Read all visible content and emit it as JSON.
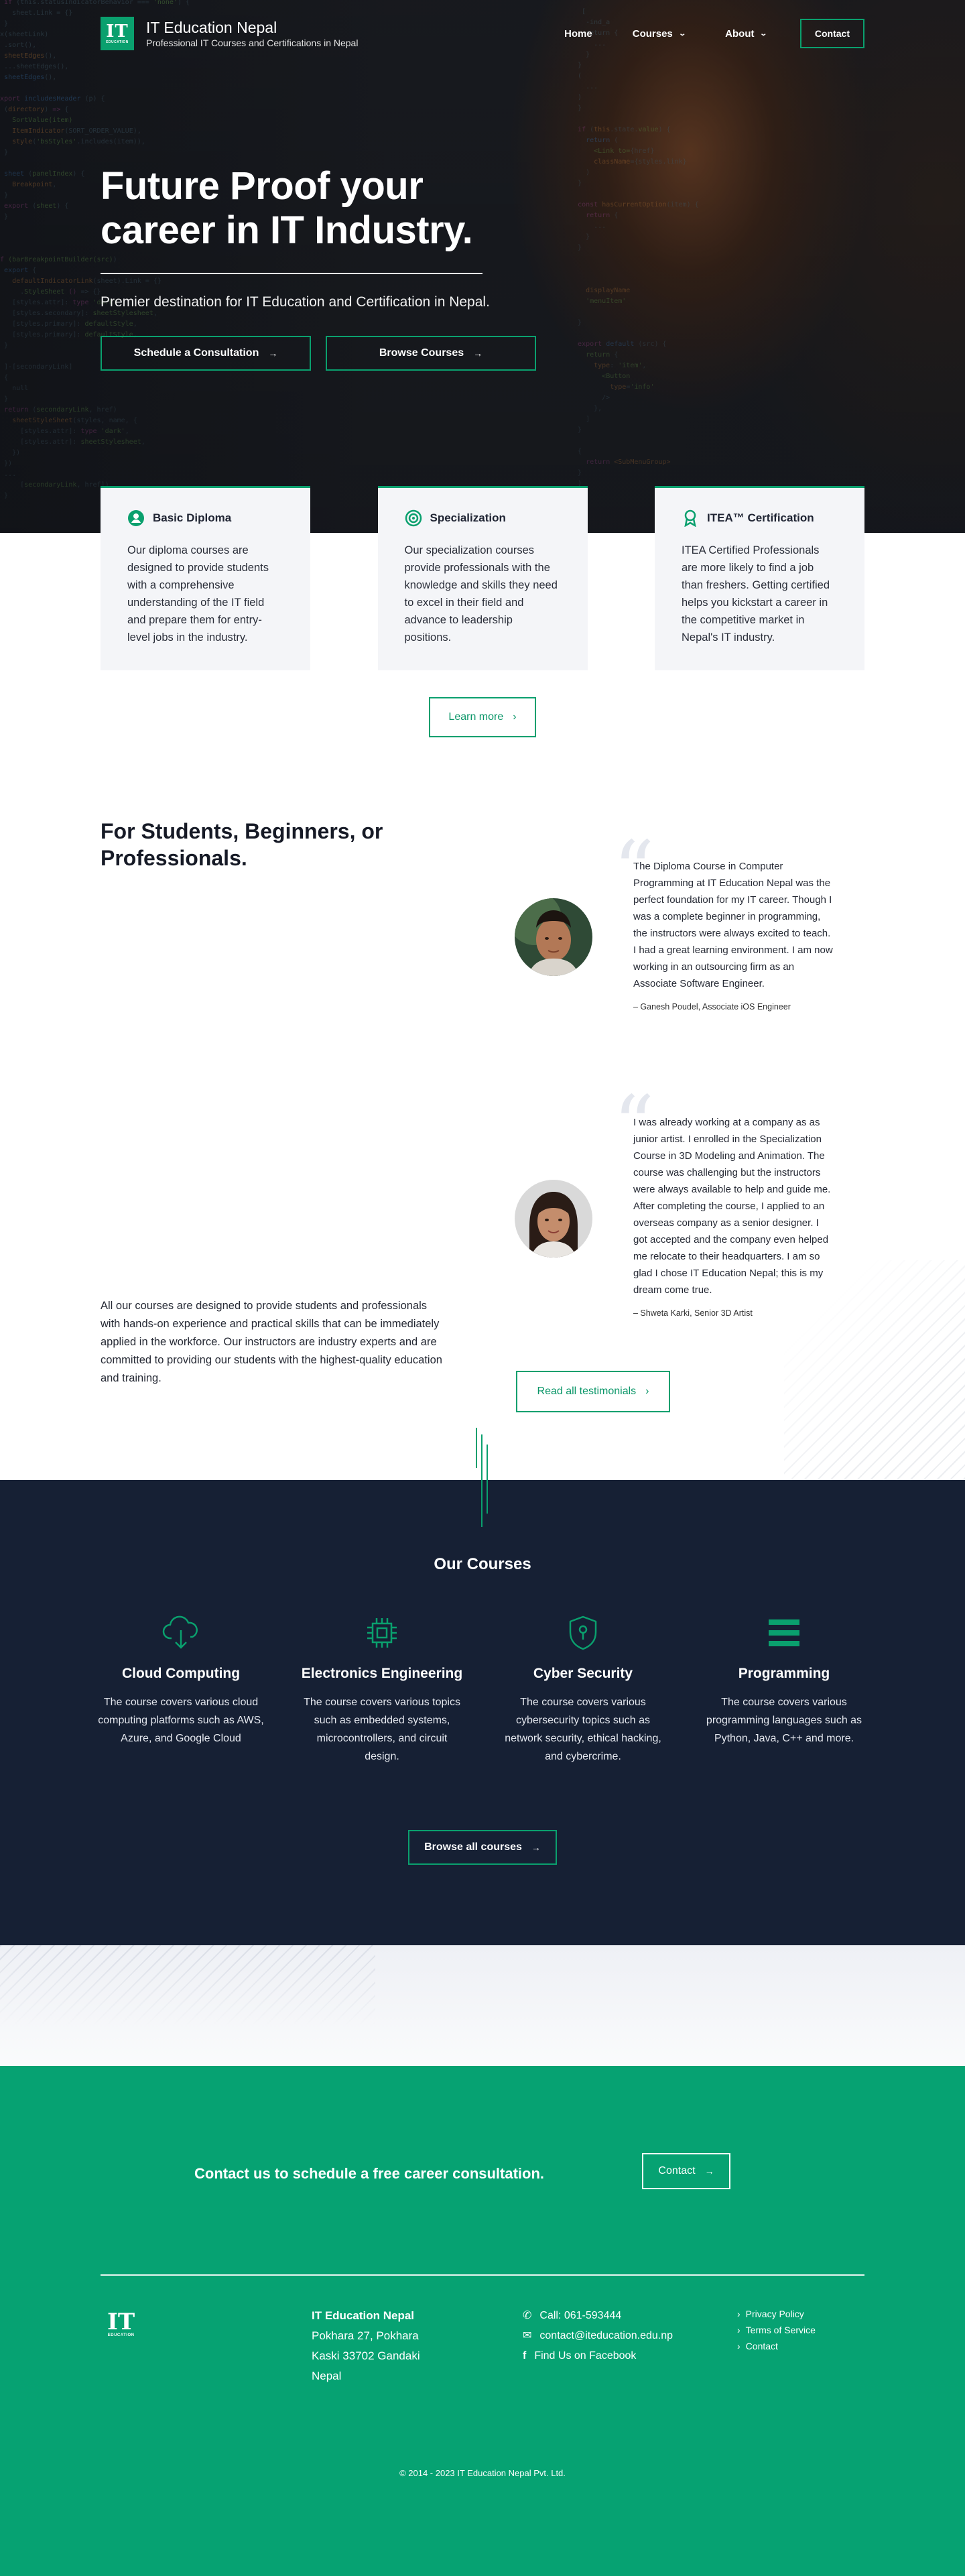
{
  "nav": {
    "logo_mark": "IT",
    "logo_sub": "EDUCATION",
    "brand_name": "IT Education Nepal",
    "brand_tagline": "Professional IT Courses and Certifications in Nepal",
    "items": [
      {
        "label": "Home"
      },
      {
        "label": "Courses"
      },
      {
        "label": "About"
      }
    ],
    "contact_label": "Contact"
  },
  "hero": {
    "title": "Future Proof your career in IT Industry.",
    "subtitle": "Premier destination for IT Education and Certification in Nepal.",
    "btn_consult": "Schedule a Consultation",
    "btn_browse": "Browse Courses"
  },
  "features": {
    "cards": [
      {
        "title": "Basic Diploma",
        "text": "Our diploma courses are designed to provide students with a comprehensive understanding of the IT field and prepare them for entry-level jobs in the industry.",
        "icon": "user-circle-icon"
      },
      {
        "title": "Specialization",
        "text": "Our specialization courses provide professionals with the knowledge and skills they need to excel in their field and advance to leadership positions.",
        "icon": "target-icon"
      },
      {
        "title": "ITEA™ Certification",
        "text": "ITEA Certified Professionals are more likely to find a job than freshers. Getting certified helps you kickstart a career in the competitive market in Nepal's IT industry.",
        "icon": "award-icon"
      }
    ],
    "learn_more": "Learn more"
  },
  "testimonials": {
    "heading": "For Students, Beginners, or Professionals.",
    "items": [
      {
        "text": "The Diploma Course in Computer Programming at IT Education Nepal was the perfect foundation for my IT career. Though I was a complete beginner in programming, the instructors were always excited to teach. I had a great learning environment. I am now working in an outsourcing firm as an Associate Software Engineer.",
        "by": "– Ganesh Poudel, Associate iOS Engineer"
      },
      {
        "text": "I was already working at a company as as junior artist. I enrolled in the Specialization Course in 3D Modeling and Animation. The course was challenging but the instructors were always available to help and guide me. After completing the course, I applied to an overseas company as a senior designer. I got accepted and the company even helped me relocate to their headquarters. I am so glad I chose IT Education Nepal; this is my dream come true.",
        "by": "– Shweta Karki, Senior 3D Artist"
      }
    ],
    "about": "All our courses are designed to provide students and professionals with hands-on experience and practical skills that can be immediately applied in the workforce. Our instructors are industry experts and are committed to providing our students with the highest-quality education and training.",
    "read_all": "Read all testimonials"
  },
  "courses": {
    "heading": "Our Courses",
    "items": [
      {
        "name": "Cloud Computing",
        "desc": "The course covers various cloud computing platforms such as AWS, Azure, and Google Cloud",
        "icon": "cloud-download-icon"
      },
      {
        "name": "Electronics Engineering",
        "desc": "The course covers various topics such as embedded systems, microcontrollers, and circuit design.",
        "icon": "chip-icon"
      },
      {
        "name": "Cyber Security",
        "desc": "The course covers various cybersecurity topics such as network security, ethical hacking, and cybercrime.",
        "icon": "shield-lock-icon"
      },
      {
        "name": "Programming",
        "desc": "The course covers various programming languages such as Python, Java, C++ and more.",
        "icon": "menu-bars-icon"
      }
    ],
    "browse_all": "Browse all courses"
  },
  "footer": {
    "cta_text": "Contact us to schedule a free career consultation.",
    "cta_button": "Contact",
    "logo_mark": "IT",
    "logo_sub": "EDUCATION",
    "org_name": "IT Education Nepal",
    "address_lines": [
      "Pokhara 27, Pokhara",
      "Kaski 33702 Gandaki",
      "Nepal"
    ],
    "phone": "Call: 061-593444",
    "email": "contact@iteducation.edu.np",
    "facebook": "Find Us on Facebook",
    "links": [
      "Privacy Policy",
      "Terms of Service",
      "Contact"
    ],
    "copyright": "© 2014 - 2023 IT Education Nepal Pvt. Ltd."
  },
  "colors": {
    "accent": "#0aa06e",
    "navy": "#162034",
    "footer_green": "#06a272"
  }
}
